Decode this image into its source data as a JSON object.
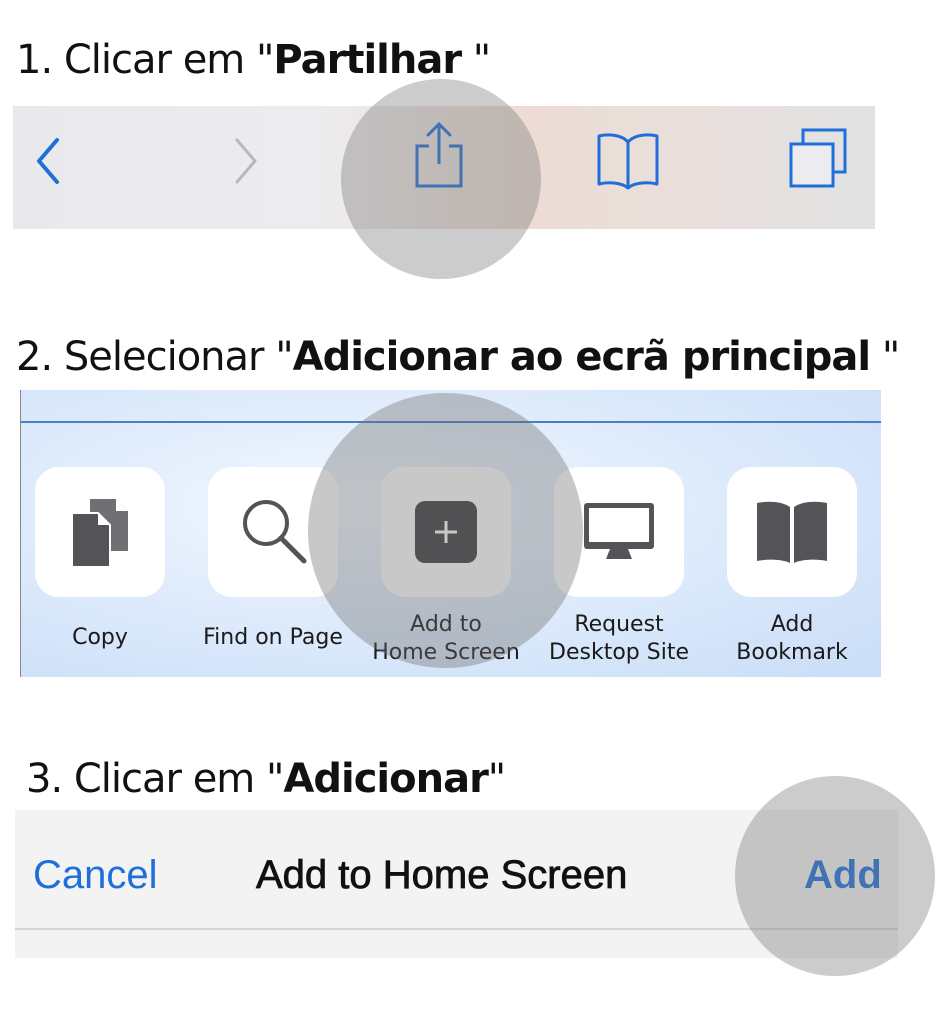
{
  "step1": {
    "title_prefix": "1. Clicar em \"",
    "title_bold": "Partilhar",
    "title_suffix": " \""
  },
  "step2": {
    "title_prefix": "2. Selecionar \"",
    "title_bold": "Adicionar ao ecrã principal",
    "title_suffix": " \"",
    "actions": [
      {
        "icon": "copy-icon",
        "line1": "",
        "line2": "Copy"
      },
      {
        "icon": "search-icon",
        "line1": "",
        "line2": "Find on Page"
      },
      {
        "icon": "add-to-home-icon",
        "line1": "Add to",
        "line2": "Home Screen"
      },
      {
        "icon": "desktop-icon",
        "line1": "Request",
        "line2": "Desktop Site"
      },
      {
        "icon": "bookmark-icon",
        "line1": "Add",
        "line2": "Bookmark"
      }
    ]
  },
  "step3": {
    "title_prefix": "3. Clicar em \"",
    "title_bold": "Adicionar",
    "title_suffix": "\"",
    "cancel_label": "Cancel",
    "nav_title": "Add to Home Screen",
    "add_label": "Add"
  },
  "colors": {
    "ios_blue": "#1e6fd9",
    "highlight": "#888888"
  }
}
